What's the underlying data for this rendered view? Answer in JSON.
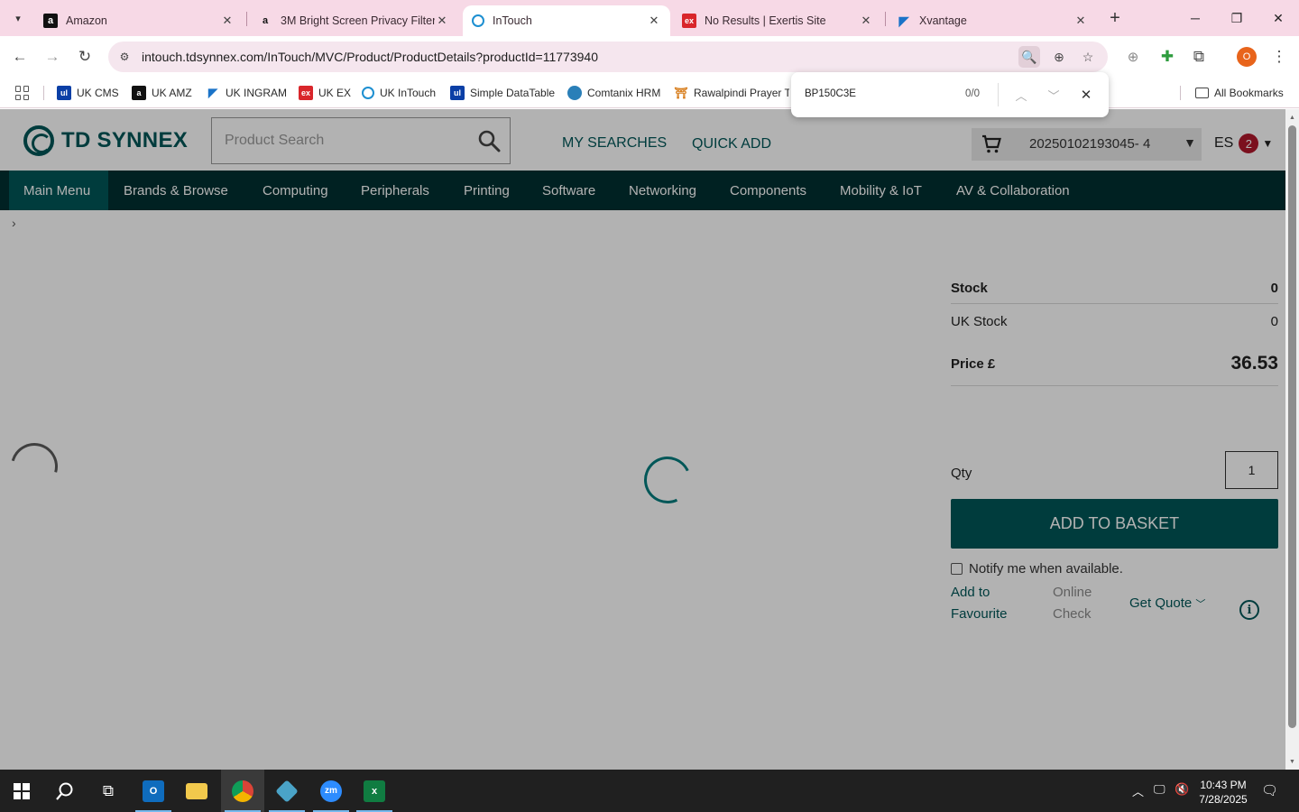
{
  "browser": {
    "tabs": [
      {
        "title": "Amazon",
        "active": false
      },
      {
        "title": "3M Bright Screen Privacy Filter",
        "active": false
      },
      {
        "title": "InTouch",
        "active": true
      },
      {
        "title": "No Results | Exertis Site",
        "active": false
      },
      {
        "title": "Xvantage",
        "active": false
      }
    ],
    "url": "intouch.tdsynnex.com/InTouch/MVC/Product/ProductDetails?productId=11773940",
    "profile_initial": "O",
    "bookmarks": [
      {
        "label": "UK CMS",
        "icon": "ul-square-icon",
        "color": "#0b3fa6"
      },
      {
        "label": "UK AMZ",
        "icon": "amazon-icon",
        "color": "#111111"
      },
      {
        "label": "UK INGRAM",
        "icon": "ingram-icon",
        "color": "#1a73c8"
      },
      {
        "label": "UK EX",
        "icon": "exertis-icon",
        "color": "#d9262b"
      },
      {
        "label": "UK InTouch",
        "icon": "intouch-icon",
        "color": "#1d8fd1"
      },
      {
        "label": "Simple DataTable",
        "icon": "ul-square-icon",
        "color": "#0b3fa6"
      },
      {
        "label": "Comtanix HRM",
        "icon": "comtanix-icon",
        "color": "#2a7fb8"
      },
      {
        "label": "Rawalpindi Prayer Ti",
        "icon": "prayer-icon",
        "color": "#d77b18"
      }
    ],
    "all_bookmarks": "All Bookmarks"
  },
  "findbar": {
    "query": "BP150C3E",
    "count": "0/0"
  },
  "site": {
    "logo": "TD SYNNEX",
    "search_placeholder": "Product Search",
    "links": [
      "MY SEARCHES",
      "QUICK ADD"
    ],
    "cart_label": "20250102193045- 4",
    "user_initials": "ES",
    "notification_count": "2",
    "nav": [
      "Main Menu",
      "Brands & Browse",
      "Computing",
      "Peripherals",
      "Printing",
      "Software",
      "Networking",
      "Components",
      "Mobility & IoT",
      "AV & Collaboration"
    ],
    "breadcrumb": "›"
  },
  "product_panel": {
    "stock_label": "Stock",
    "stock_value": "0",
    "uk_stock_label": "UK Stock",
    "uk_stock_value": "0",
    "price_label": "Price £",
    "price_value": "36.53",
    "qty_label": "Qty",
    "qty_value": "1",
    "add_button": "ADD TO BASKET",
    "notify_label": "Notify me when available.",
    "add_favourite": [
      "Add to",
      "Favourite"
    ],
    "online_check": [
      "Online",
      "Check"
    ],
    "get_quote": "Get Quote",
    "info_symbol": "i"
  },
  "taskbar": {
    "time": "10:43 PM",
    "date": "7/28/2025",
    "apps": [
      "start",
      "search",
      "task-view",
      "outlook",
      "file-explorer",
      "chrome",
      "app",
      "zoom",
      "excel"
    ]
  },
  "colors": {
    "brand_teal": "#005758",
    "nav_dark": "#003031",
    "tab_strip": "#f7d9e6",
    "badge_red": "#b0182c"
  }
}
